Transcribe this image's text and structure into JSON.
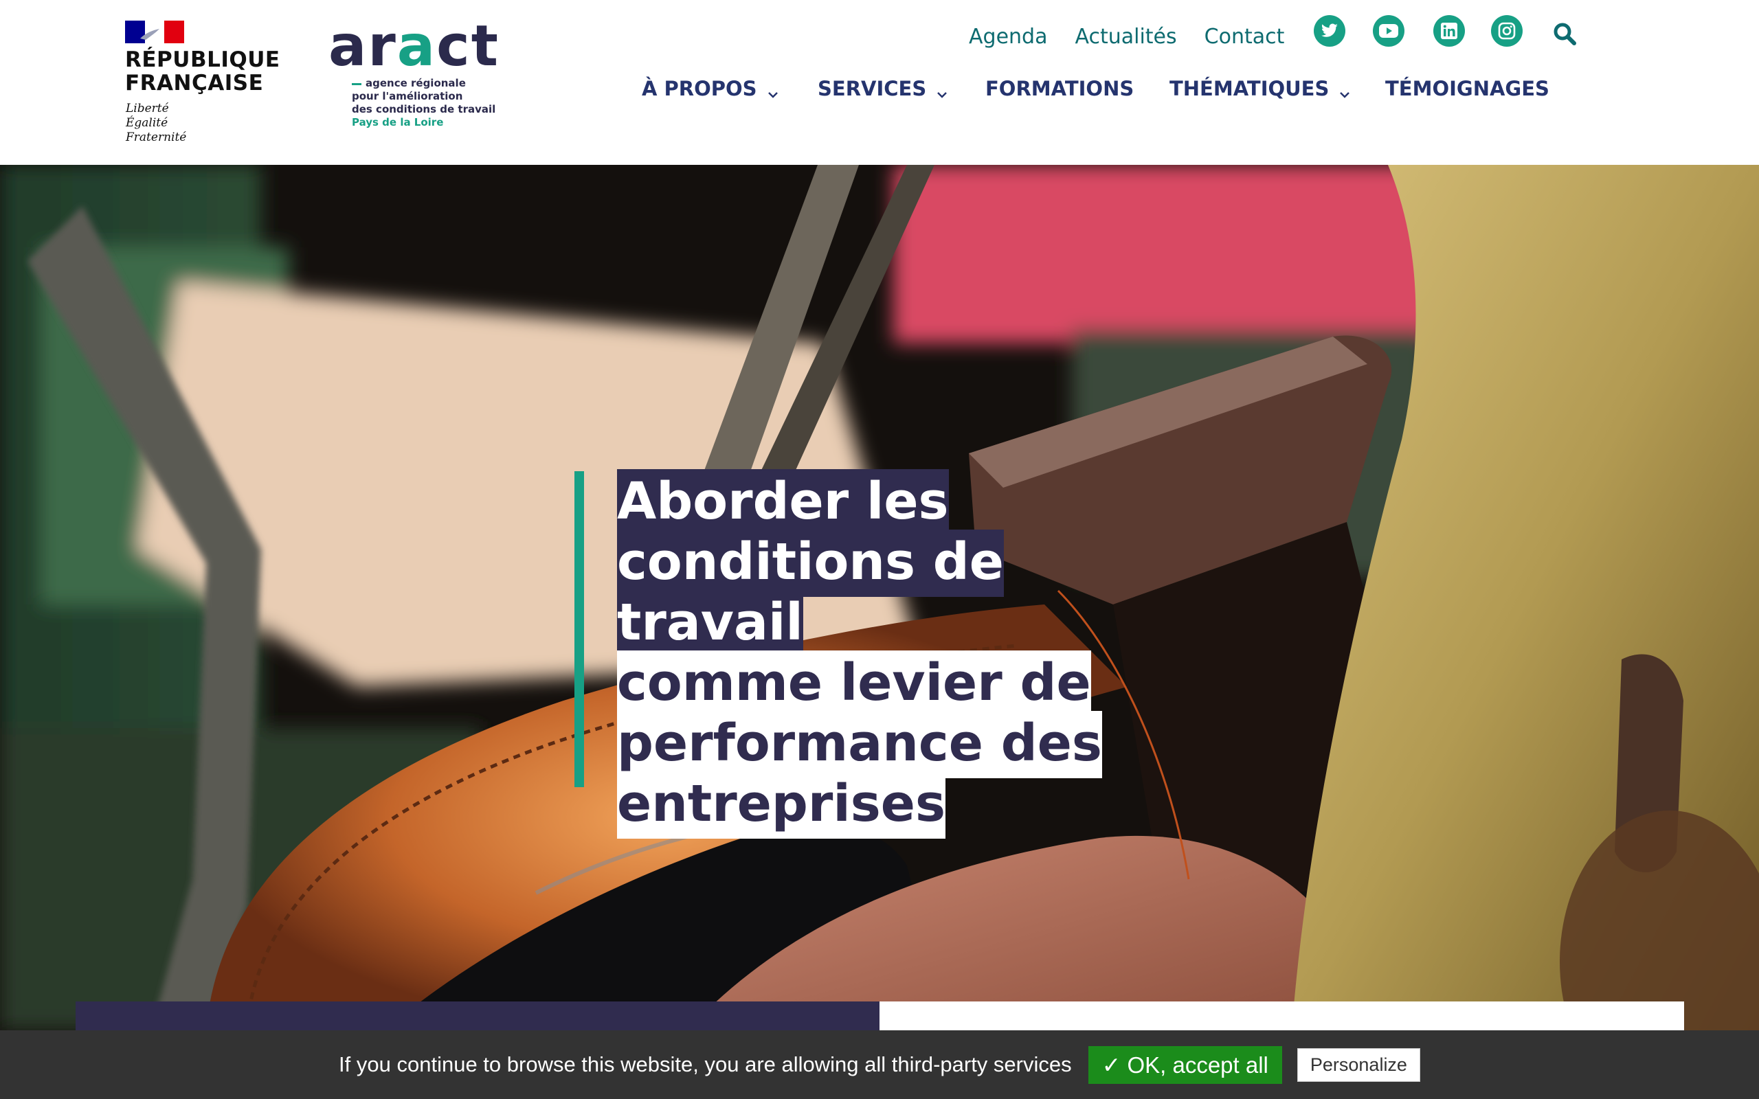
{
  "brand": {
    "republique": {
      "line1": "RÉPUBLIQUE",
      "line2": "FRANÇAISE",
      "motto": [
        "Liberté",
        "Égalité",
        "Fraternité"
      ]
    },
    "aract": {
      "wordmark_pre": "ar",
      "wordmark_teal": "a",
      "wordmark_post": "ct",
      "tagline": [
        "agence régionale",
        "pour l'amélioration",
        "des conditions de travail"
      ],
      "region": "Pays de la Loire"
    }
  },
  "top_links": [
    {
      "label": "Agenda"
    },
    {
      "label": "Actualités"
    },
    {
      "label": "Contact"
    }
  ],
  "social": [
    {
      "name": "twitter-icon"
    },
    {
      "name": "youtube-icon"
    },
    {
      "name": "linkedin-icon"
    },
    {
      "name": "instagram-icon"
    }
  ],
  "nav": [
    {
      "label": "À PROPOS",
      "has_dropdown": true
    },
    {
      "label": "SERVICES",
      "has_dropdown": true
    },
    {
      "label": "FORMATIONS",
      "has_dropdown": false
    },
    {
      "label": "THÉMATIQUES",
      "has_dropdown": true
    },
    {
      "label": "TÉMOIGNAGES",
      "has_dropdown": false
    }
  ],
  "hero": {
    "title_lines": [
      {
        "text": "Aborder les",
        "style": "dark"
      },
      {
        "text": "conditions de travail",
        "style": "dark"
      },
      {
        "text": "comme levier de",
        "style": "light"
      },
      {
        "text": "performance des",
        "style": "light"
      },
      {
        "text": "entreprises",
        "style": "light"
      }
    ]
  },
  "cookie": {
    "message": "If you continue to browse this website, you are allowing all third-party services",
    "accept_label": "✓ OK, accept all",
    "personalize_label": "Personalize"
  },
  "colors": {
    "teal": "#17a085",
    "navy": "#302c4f",
    "nav_text": "#25346e",
    "link_text": "#0e6b70",
    "cookie_bg": "#333333",
    "accept_bg": "#1b8c1b"
  }
}
